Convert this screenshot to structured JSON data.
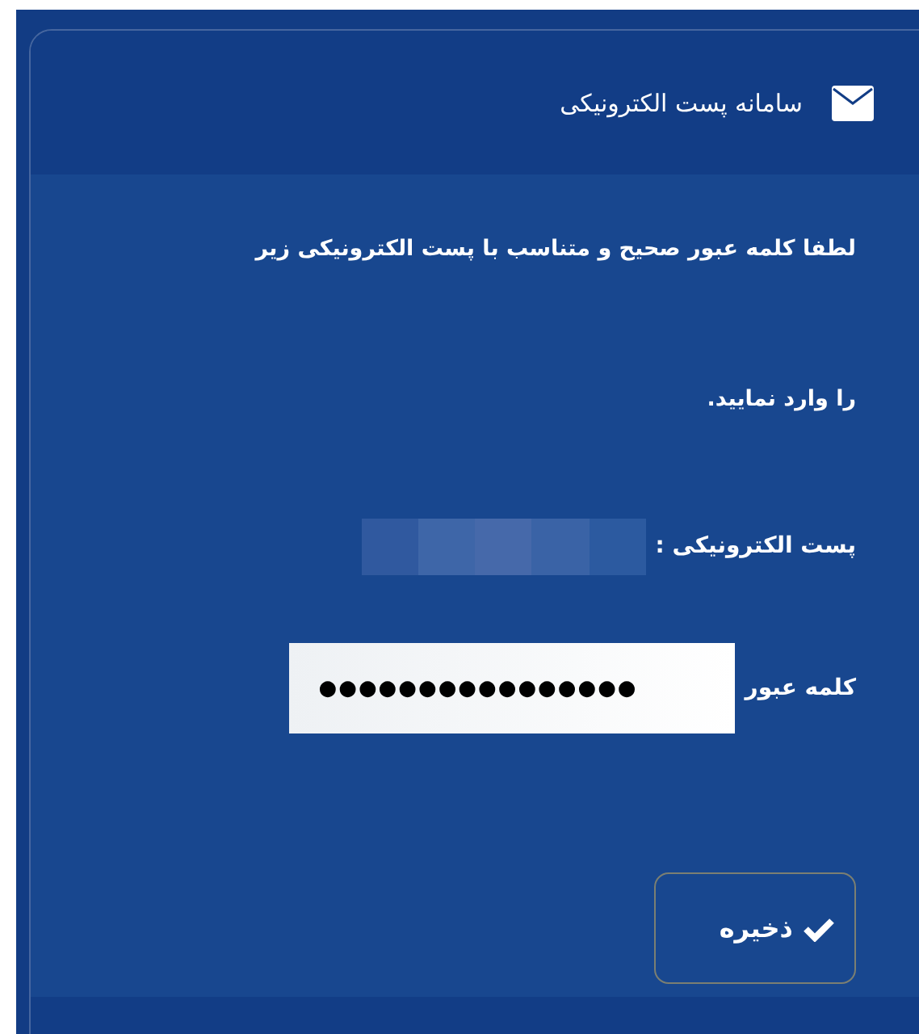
{
  "panel": {
    "title": "سامانه پست الکترونیکی"
  },
  "instructions": [
    "لطفا کلمه عبور صحیح و متناسب با پست الکترونیکی زیر",
    "را وارد نمایید."
  ],
  "email": {
    "label": "پست الکترونیکی :",
    "redacted": true
  },
  "password": {
    "label": "کلمه عبور",
    "value": "●●●●●●●●●●●●●●●●"
  },
  "save_button": {
    "label": "ذخیره"
  }
}
